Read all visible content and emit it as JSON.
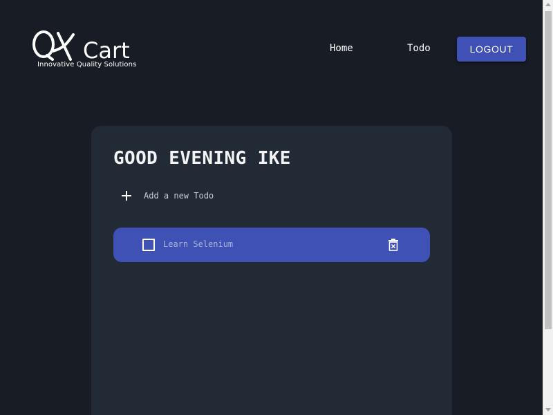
{
  "header": {
    "logo_text": "QKart",
    "logo_tagline": "Innovative Quality Solutions",
    "nav": [
      {
        "label": "Home"
      },
      {
        "label": "Todo"
      }
    ],
    "logout_label": "LOGOUT"
  },
  "main": {
    "greeting": "GOOD EVENING IKE",
    "add_placeholder": "Add a new Todo",
    "todos": [
      {
        "text": "Learn Selenium",
        "completed": false
      }
    ]
  },
  "icons": {
    "add": "plus-icon",
    "checkbox": "checkbox-icon",
    "delete": "trash-icon"
  },
  "colors": {
    "background": "#181c24",
    "card": "#222a36",
    "accent": "#3f51b5",
    "text": "#ffffff"
  }
}
